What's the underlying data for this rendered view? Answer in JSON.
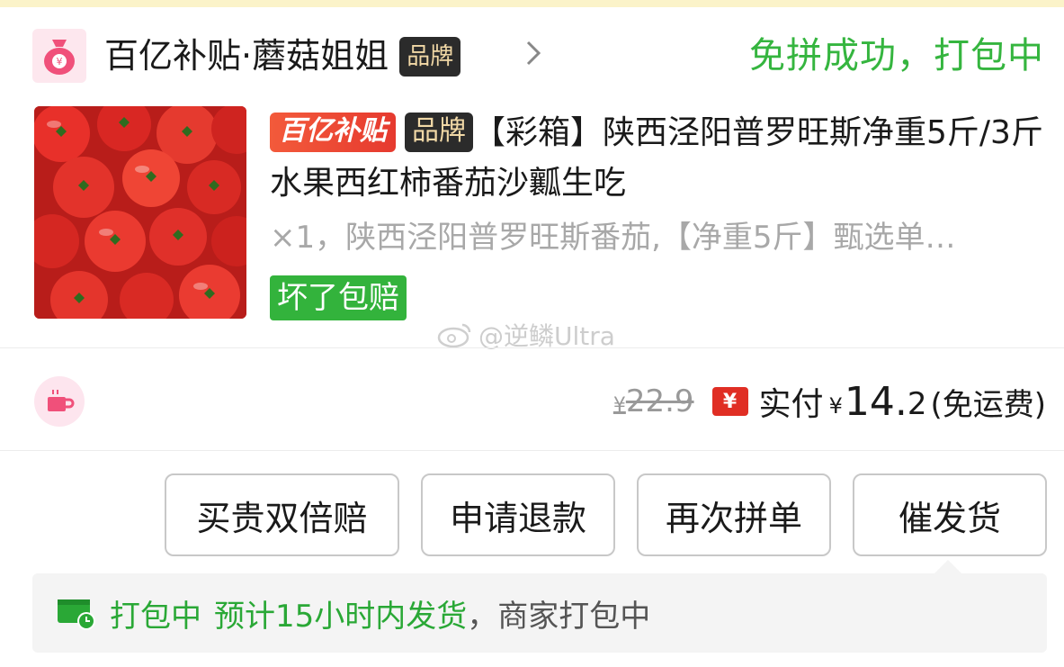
{
  "header": {
    "shop_name": "百亿补贴·蘑菇姐姐",
    "brand_badge": "品牌",
    "status": "免拼成功，打包中"
  },
  "product": {
    "subsidy_badge": "百亿补贴",
    "brand_badge": "品牌",
    "title": "【彩箱】陕西泾阳普罗旺斯净重5斤/3斤水果西红柿番茄沙瓤生吃",
    "spec": "×1，陕西泾阳普罗旺斯番茄,【净重5斤】甄选单…",
    "guarantee_tag": "坏了包赔",
    "image_alt": "tomatoes"
  },
  "watermark": "@逆鳞Ultra",
  "price": {
    "original_currency": "¥",
    "original": "22.9",
    "yuan_icon": "¥",
    "paid_label": "实付",
    "paid_currency": "¥",
    "paid_int": "14.",
    "paid_dec": "2",
    "shipping": "(免运费)"
  },
  "actions": {
    "double_compensation": "买贵双倍赔",
    "refund": "申请退款",
    "reorder": "再次拼单",
    "urge_shipping": "催发货"
  },
  "logistics": {
    "status": "打包中",
    "eta": "预计15小时内发货",
    "sep": "，",
    "detail": "商家打包中"
  },
  "colors": {
    "green": "#35b53f",
    "red": "#e02e24",
    "brand_dark": "#2b2b2b"
  }
}
